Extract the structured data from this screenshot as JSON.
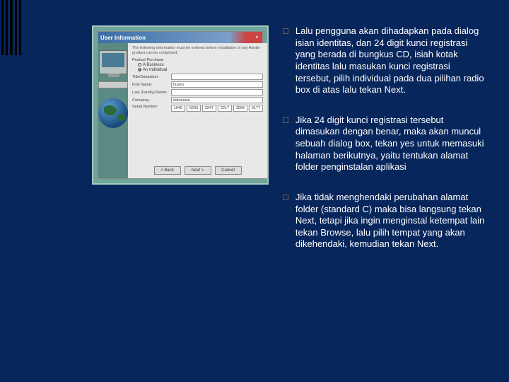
{
  "dialog": {
    "title": "User Information",
    "help": "The following information must be entered before installation of any Adobe product can be completed.",
    "radio_group_label": "Product Purchase:",
    "radio1": "A Business",
    "radio2": "An Individual",
    "fields": {
      "title_label": "Title/Salutation:",
      "title_value": "",
      "first_label": "First Name:",
      "first_value": "husen",
      "last_label": "Last (Family) Name:",
      "last_value": "",
      "company_label": "Company:",
      "company_value": "indonesia",
      "serial_label": "Serial Number:"
    },
    "serial": [
      "1045",
      "0203",
      "3247",
      "2217",
      "3566",
      "9177"
    ],
    "buttons": {
      "back": "< Back",
      "next": "Next >",
      "cancel": "Cancel"
    }
  },
  "bullets": [
    "Lalu pengguna akan dihadapkan pada dialog isian identitas, dan 24 digit kunci registrasi yang berada di bungkus CD, isiah kotak identitas lalu masukan kunci registrasi tersebut, pilih individual  pada dua pilihan radio box di atas lalu tekan Next.",
    "Jika 24 digit kunci registrasi tersebut dimasukan dengan benar, maka akan muncul sebuah dialog box, tekan yes untuk memasuki halaman berikutnya, yaitu tentukan alamat folder penginstalan aplikasi",
    "Jika tidak menghendaki perubahan alamat folder (standard C) maka bisa langsung tekan Next, tetapi jika ingin menginstal ketempat lain tekan Browse, lalu pilih tempat yang akan dikehendaki, kemudian tekan Next."
  ]
}
